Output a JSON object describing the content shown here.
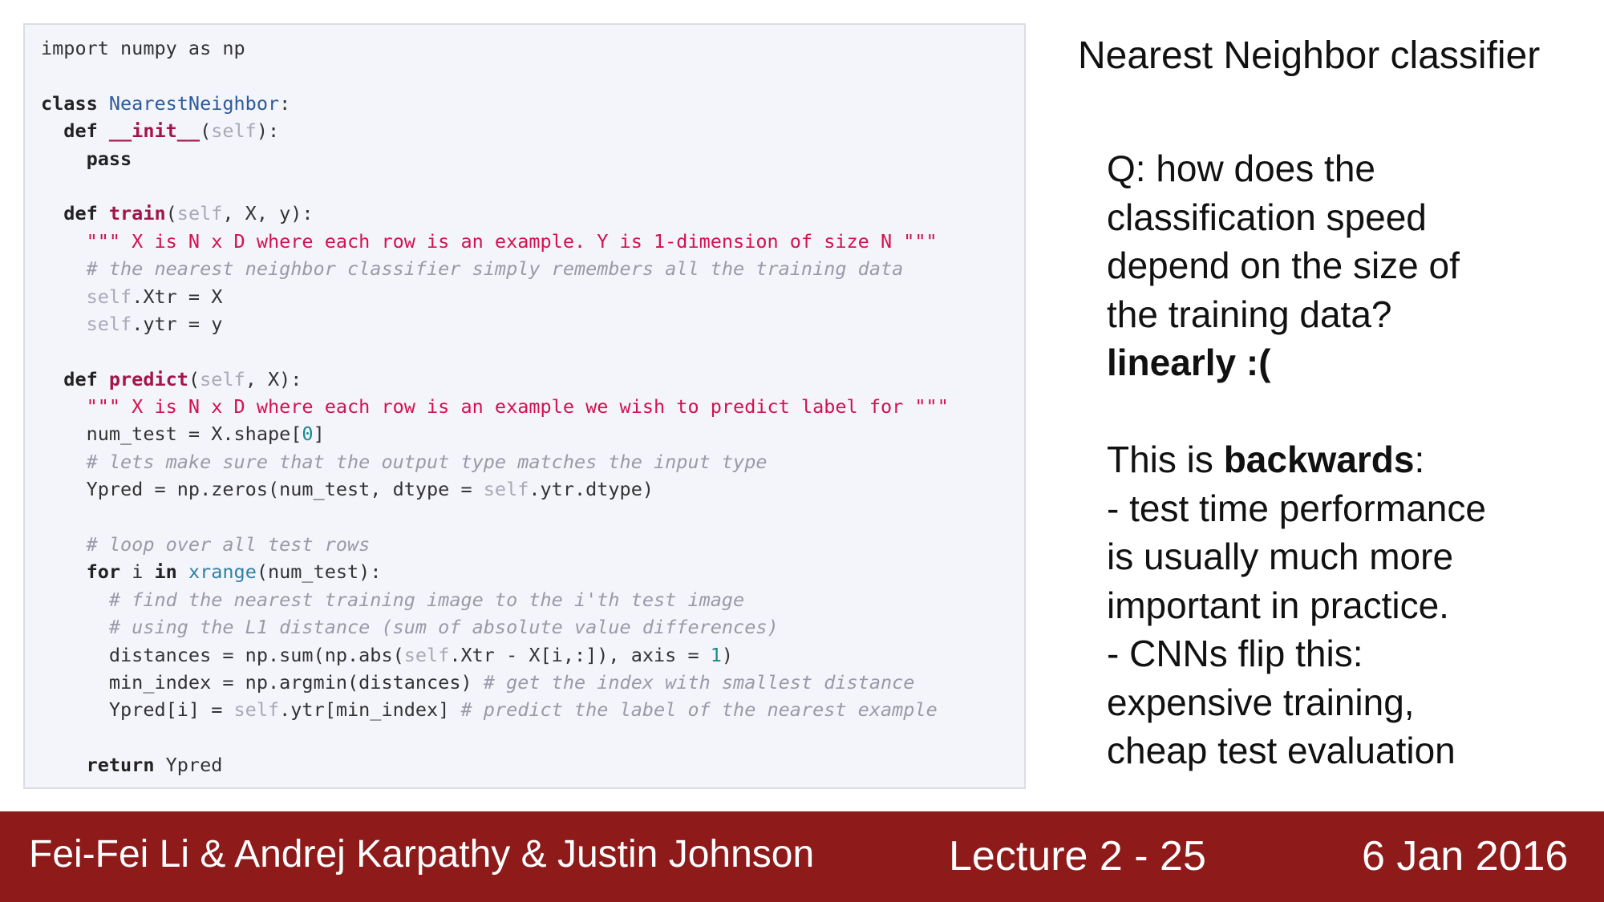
{
  "slide": {
    "title": "Nearest Neighbor classifier",
    "q_lines": [
      "Q: how does the",
      "classification speed",
      "depend on the size of",
      "the training data?"
    ],
    "answer": "linearly :(",
    "this_is": "This is ",
    "backwards": "backwards",
    "colon": ":",
    "points": [
      "- test time performance",
      "is usually much more",
      "important in practice.",
      "- CNNs flip this:",
      "expensive training,",
      "cheap test evaluation"
    ]
  },
  "code": {
    "l1": "import numpy as np",
    "l3_kw": "class ",
    "l3_name": "NearestNeighbor",
    "l3_end": ":",
    "l4_kw": "  def ",
    "l4_fn": "__init__",
    "l4_p1": "(",
    "l4_self": "self",
    "l4_p2": "):",
    "l5": "    pass",
    "l7_kw": "  def ",
    "l7_fn": "train",
    "l7_p1": "(",
    "l7_self": "self",
    "l7_rest": ", X, y):",
    "l8": "    \"\"\" X is N x D where each row is an example. Y is 1-dimension of size N \"\"\"",
    "l9": "    # the nearest neighbor classifier simply remembers all the training data",
    "l10_self": "    self",
    "l10_rest": ".Xtr = X",
    "l11_self": "    self",
    "l11_rest": ".ytr = y",
    "l13_kw": "  def ",
    "l13_fn": "predict",
    "l13_p1": "(",
    "l13_self": "self",
    "l13_rest": ", X):",
    "l14": "    \"\"\" X is N x D where each row is an example we wish to predict label for \"\"\"",
    "l15_a": "    num_test = X.shape[",
    "l15_num": "0",
    "l15_b": "]",
    "l16": "    # lets make sure that the output type matches the input type",
    "l17_a": "    Ypred = np.zeros(num_test, dtype = ",
    "l17_self": "self",
    "l17_b": ".ytr.dtype)",
    "l19": "    # loop over all test rows",
    "l20_kw1": "    for",
    "l20_a": " i ",
    "l20_kw2": "in",
    "l20_sp": " ",
    "l20_builtin": "xrange",
    "l20_b": "(num_test):",
    "l21": "      # find the nearest training image to the i'th test image",
    "l22": "      # using the L1 distance (sum of absolute value differences)",
    "l23_a": "      distances = np.sum(np.abs(",
    "l23_self": "self",
    "l23_b": ".Xtr - X[i,:]), axis = ",
    "l23_num": "1",
    "l23_c": ")",
    "l24_a": "      min_index = np.argmin(distances) ",
    "l24_cm": "# get the index with smallest distance",
    "l25_a": "      Ypred[i] = ",
    "l25_self": "self",
    "l25_b": ".ytr[min_index] ",
    "l25_cm": "# predict the label of the nearest example",
    "l27_kw": "    return",
    "l27_rest": " Ypred"
  },
  "footer": {
    "authors": "Fei-Fei Li & Andrej Karpathy & Justin Johnson",
    "lecture": "Lecture 2 - 25",
    "date": "6 Jan 2016"
  },
  "colors": {
    "footer_bg": "#8e1a1a",
    "code_bg": "#f4f4fb",
    "string": "#d3124f",
    "function_name": "#a3154a",
    "class_name": "#2d5b9a",
    "comment": "#9a9aa8"
  }
}
